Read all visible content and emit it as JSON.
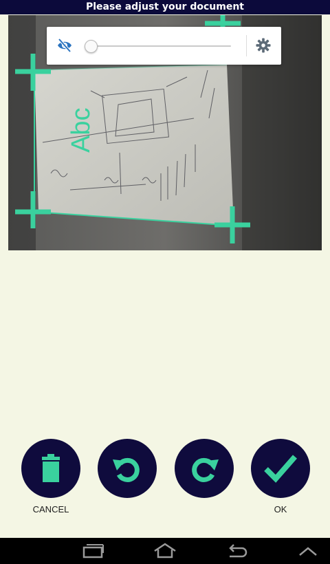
{
  "status_bar": {
    "title": "Please adjust your document"
  },
  "preview": {
    "overlay_text": "Abc",
    "accent_color": "#3ad19e"
  },
  "adjust_panel": {
    "visibility_icon": "eye-off-icon",
    "slider_value": 0,
    "settings_icon": "gear-icon"
  },
  "actions": {
    "cancel": {
      "label": "CANCEL",
      "icon": "trash-icon"
    },
    "rotate_left": {
      "label": "",
      "icon": "rotate-ccw-icon"
    },
    "rotate_right": {
      "label": "",
      "icon": "rotate-cw-icon"
    },
    "ok": {
      "label": "OK",
      "icon": "checkmark-icon"
    }
  },
  "nav_bar": {
    "icons": [
      "recent-apps-icon",
      "home-icon",
      "back-icon",
      "collapse-icon"
    ]
  },
  "colors": {
    "button_bg": "#0f0b3d",
    "accent": "#3ad19e",
    "background": "#f4f6e4"
  }
}
